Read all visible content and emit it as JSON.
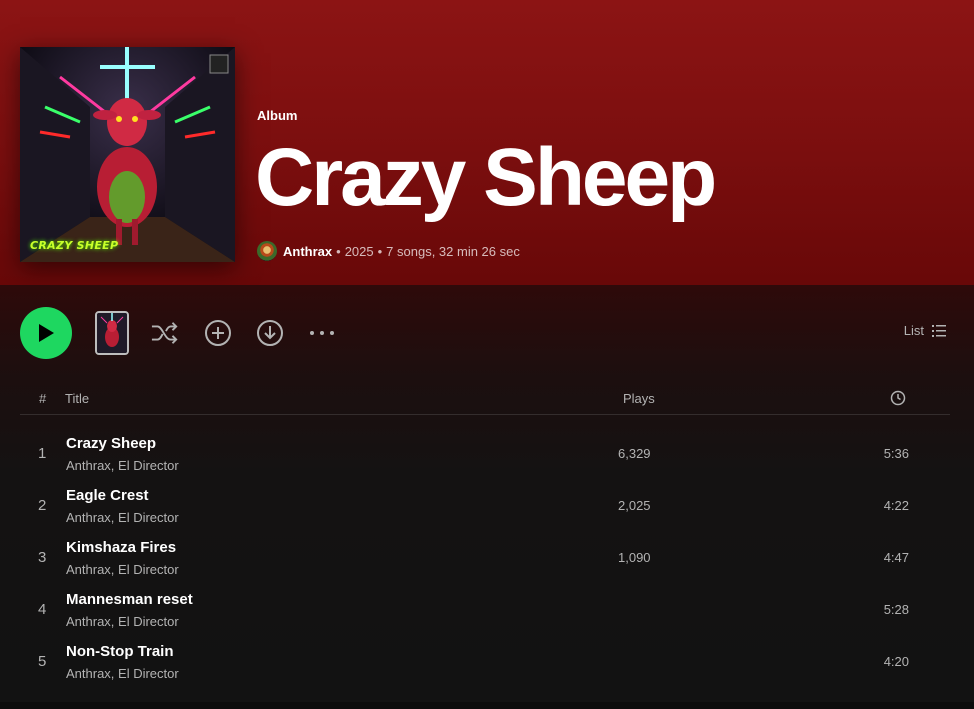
{
  "album": {
    "type_label": "Album",
    "title": "Crazy Sheep",
    "artist": "Anthrax",
    "separator": "•",
    "year": "2025",
    "summary": "7 songs, 32 min 26 sec",
    "cover_text": "CRAZY SHEEP"
  },
  "actions": {
    "play_icon": "play-icon",
    "shuffle_icon": "shuffle-icon",
    "add_icon": "add-circle-icon",
    "download_icon": "download-icon",
    "more_icon": "more-dots-icon",
    "view_label": "List",
    "view_icon": "list-icon"
  },
  "table": {
    "headers": {
      "number": "#",
      "title": "Title",
      "plays": "Plays",
      "duration_icon": "clock-icon"
    },
    "tracks": [
      {
        "number": "1",
        "title": "Crazy Sheep",
        "artists": "Anthrax, El Director",
        "plays": "6,329",
        "duration": "5:36"
      },
      {
        "number": "2",
        "title": "Eagle Crest",
        "artists": "Anthrax, El Director",
        "plays": "2,025",
        "duration": "4:22"
      },
      {
        "number": "3",
        "title": "Kimshaza Fires",
        "artists": "Anthrax, El Director",
        "plays": "1,090",
        "duration": "4:47"
      },
      {
        "number": "4",
        "title": "Mannesman reset",
        "artists": "Anthrax, El Director",
        "plays": "",
        "duration": "5:28"
      },
      {
        "number": "5",
        "title": "Non-Stop Train",
        "artists": "Anthrax, El Director",
        "plays": "",
        "duration": "4:20"
      }
    ]
  },
  "colors": {
    "header_bg": "#8c1414",
    "accent_green": "#1ed760",
    "page_bg": "#121212",
    "muted_text": "#b3b3b3"
  }
}
